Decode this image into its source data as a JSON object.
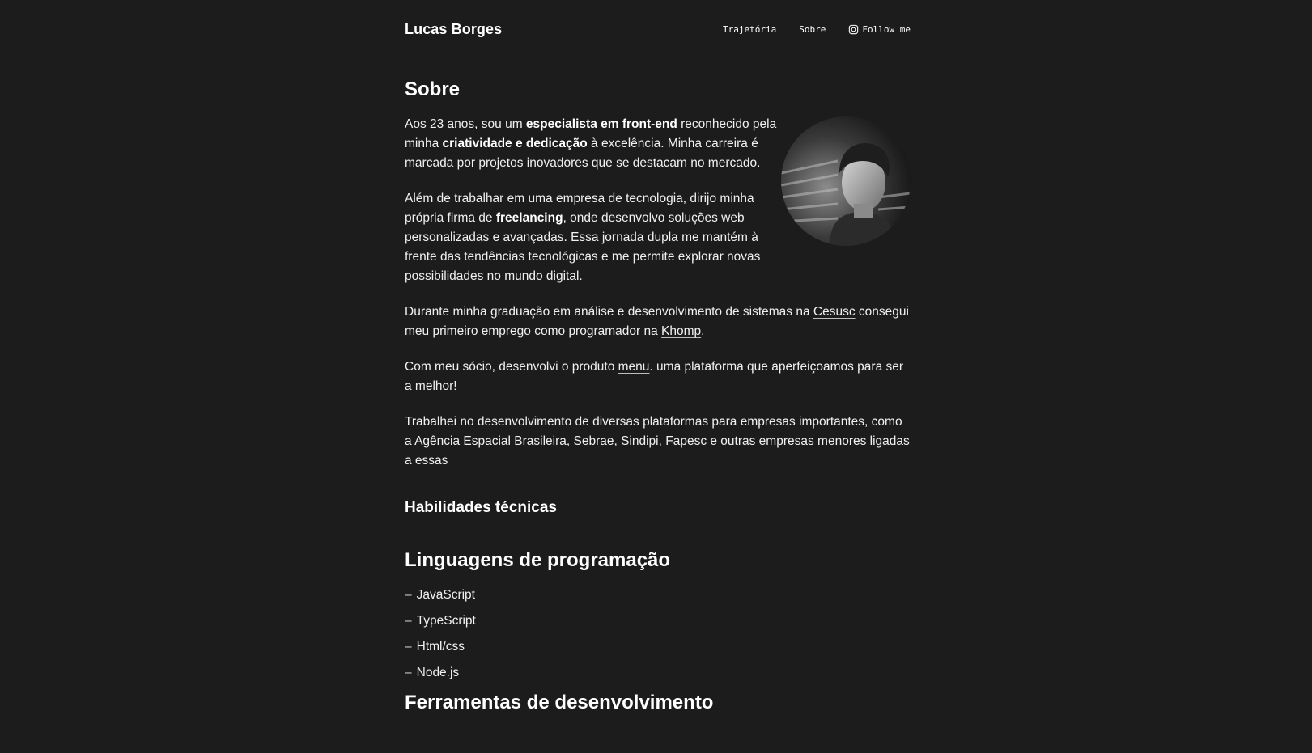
{
  "header": {
    "brand": "Lucas Borges",
    "nav": {
      "trajetoria": "Trajetória",
      "sobre": "Sobre",
      "follow": "Follow me"
    }
  },
  "about": {
    "title": "Sobre",
    "p1": {
      "t1": "Aos 23 anos, sou um ",
      "b1": "especialista em front-end",
      "t2": " reconhecido pela minha ",
      "b2": "criatividade e dedicação",
      "t3": " à excelência. Minha carreira é marcada por projetos inovadores que se destacam no mercado."
    },
    "p2": {
      "t1": "Além de trabalhar em uma empresa de tecnologia, dirijo minha própria firma de ",
      "b1": "freelancing",
      "t2": ", onde desenvolvo soluções web personalizadas e avançadas. Essa jornada dupla me mantém à frente das tendências tecnológicas e me permite explorar novas possibilidades no mundo digital."
    },
    "p3": {
      "t1": "Durante minha graduação em análise e desenvolvimento de sistemas na ",
      "link1": "Cesusc",
      "t2": " consegui meu primeiro emprego como programador na ",
      "link2": "Khomp",
      "t3": "."
    },
    "p4": {
      "t1": "Com meu sócio, desenvolvi o produto ",
      "link1": "menu",
      "t2": ". uma plataforma que aperfeiçoamos para ser a melhor!"
    },
    "p5": "Trabalhei no desenvolvimento de diversas plataformas para empresas importantes, como a Agência Espacial Brasileira, Sebrae, Sindipi, Fapesc e outras empresas menores ligadas a essas"
  },
  "skills": {
    "heading": "Habilidades técnicas",
    "languages_heading": "Linguagens de programação",
    "dash": "–",
    "languages": [
      "JavaScript",
      "TypeScript",
      "Html/css",
      "Node.js"
    ],
    "tools_heading": "Ferramentas de desenvolvimento"
  },
  "icons": {
    "instagram": "instagram-icon",
    "avatar": "profile-photo"
  }
}
